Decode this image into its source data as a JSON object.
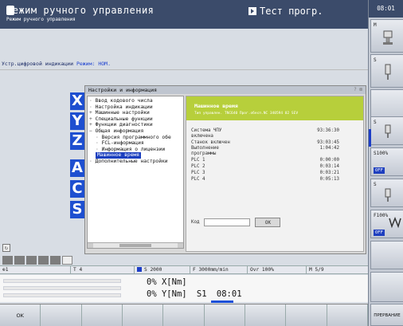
{
  "header": {
    "mode_title": "Режим ручного управления",
    "mode_subtitle": "Режим ручного управления",
    "program_mode": "Тест прогр."
  },
  "clock": "08:01",
  "infoline": {
    "label": "Устр.цифровой индикации",
    "mode_label": "Режим:",
    "mode_value": "НОМ."
  },
  "axes": [
    "X",
    "Y",
    "Z",
    "A",
    "C",
    "S"
  ],
  "dialog": {
    "title": "Настройки и информация",
    "tree": [
      {
        "label": "Ввод кодового числа",
        "level": 0,
        "kind": "leaf"
      },
      {
        "label": "Настройка индикации",
        "level": 0,
        "kind": "leaf"
      },
      {
        "label": "Машинные настройки",
        "level": 0,
        "kind": "exp"
      },
      {
        "label": "Специальные функции",
        "level": 0,
        "kind": "exp"
      },
      {
        "label": "Функции диагностики",
        "level": 0,
        "kind": "exp"
      },
      {
        "label": "Общая информация",
        "level": 0,
        "kind": "col"
      },
      {
        "label": "Версия программного обе",
        "level": 1,
        "kind": "leaf"
      },
      {
        "label": "FCL-информация",
        "level": 1,
        "kind": "leaf"
      },
      {
        "label": "Информация о лицензии",
        "level": 1,
        "kind": "leaf"
      },
      {
        "label": "Машинное время",
        "level": 1,
        "kind": "sel"
      },
      {
        "label": "Дополнительные настройки",
        "level": 0,
        "kind": "leaf"
      }
    ],
    "panel": {
      "heading": "Машинное время",
      "subheading": "Тип управлен.  TNC640 Прог.обесп.NC  340594 02 SEV",
      "rows": [
        {
          "label": "Система ЧПУ",
          "label2": "включена",
          "value": "93:36:30"
        },
        {
          "label": "Станок включен",
          "label2": "",
          "value": "93:03:45"
        },
        {
          "label": "Выполнение",
          "label2": "программы",
          "value": "1:04:42"
        },
        {
          "label": "PLC 1",
          "label2": "",
          "value": "0:00:00"
        },
        {
          "label": "PLC 2",
          "label2": "",
          "value": "0:03:14"
        },
        {
          "label": "PLC 3",
          "label2": "",
          "value": "0:03:21"
        },
        {
          "label": "PLC 4",
          "label2": "",
          "value": "0:05:13"
        }
      ],
      "code_label": "Код",
      "ok_label": "OK"
    }
  },
  "status": {
    "tool_marker": "⊕1",
    "tool": "T 4",
    "spindle": "S 2000",
    "feed": "F 3000mm/min",
    "override": "Ovr 100%",
    "mfunc": "M 5/9"
  },
  "positions": [
    {
      "pct": "0%",
      "axis": "X[Nm]"
    },
    {
      "pct": "0%",
      "axis": "Y[Nm]",
      "spindle": "S1",
      "time": "08:01"
    }
  ],
  "softkeys": [
    "OK",
    "",
    "",
    "",
    "",
    "",
    "",
    "",
    ""
  ],
  "right_keys": {
    "m_label": "M",
    "s_label": "S",
    "s_label2": "S",
    "s100": "S100%",
    "off": "OFF",
    "s_label3": "S",
    "f100": "F100%",
    "off2": "OFF",
    "bottom_label": "ПРЕРВАНИЕ"
  },
  "colors": {
    "header_bg": "#3b4b6a",
    "accent_blue": "#1e4fd0",
    "panel_head": "#b7cf3b"
  }
}
